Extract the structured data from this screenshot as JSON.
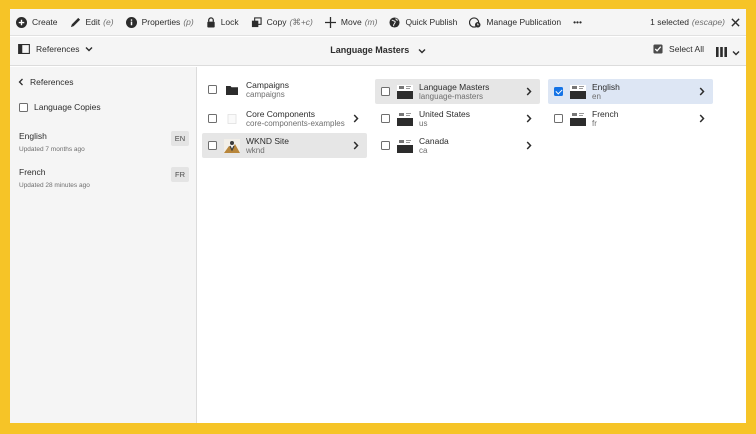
{
  "actionbar": {
    "create": "Create",
    "edit": "Edit",
    "edit_key": "(e)",
    "properties": "Properties",
    "properties_key": "(p)",
    "lock": "Lock",
    "copy": "Copy",
    "copy_key": "(⌘+c)",
    "move": "Move",
    "move_key": "(m)",
    "quick_publish": "Quick Publish",
    "manage_publication": "Manage Publication",
    "more": "•••",
    "selected_count": "1 selected",
    "escape_key": "(escape)"
  },
  "titlebar": {
    "rail_label": "References",
    "title": "Language Masters",
    "select_all": "Select All"
  },
  "rail": {
    "back_label": "References",
    "filter_label": "Language Copies",
    "items": [
      {
        "name": "English",
        "updated": "Updated 7 months ago",
        "code": "EN"
      },
      {
        "name": "French",
        "updated": "Updated 28 minutes ago",
        "code": "FR"
      }
    ]
  },
  "columns": [
    {
      "items": [
        {
          "title": "Campaigns",
          "name": "campaigns"
        },
        {
          "title": "Core Components",
          "name": "core-components-examples"
        },
        {
          "title": "WKND Site",
          "name": "wknd"
        }
      ]
    },
    {
      "items": [
        {
          "title": "Language Masters",
          "name": "language-masters"
        },
        {
          "title": "United States",
          "name": "us"
        },
        {
          "title": "Canada",
          "name": "ca"
        }
      ]
    },
    {
      "items": [
        {
          "title": "English",
          "name": "en",
          "selected": true
        },
        {
          "title": "French",
          "name": "fr"
        }
      ]
    }
  ],
  "colors": {
    "frame": "#f6c427",
    "accent": "#1473e6",
    "selected_row": "#dde6f4",
    "highlight_row": "#e6e6e6"
  }
}
